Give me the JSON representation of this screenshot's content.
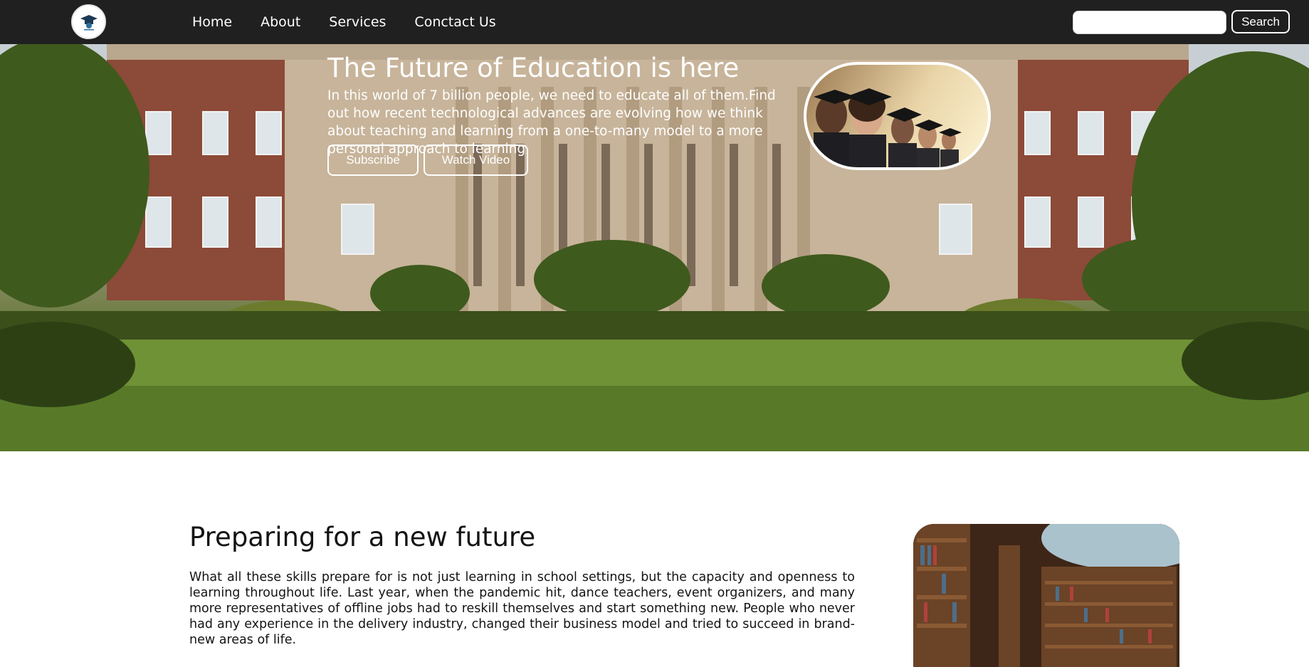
{
  "navbar": {
    "logo_icon": "graduation-cap-logo-icon",
    "links": [
      "Home",
      "About",
      "Services",
      "Conctact Us"
    ],
    "search": {
      "placeholder": "",
      "value": ""
    },
    "search_button_label": "Search"
  },
  "hero": {
    "title": "The Future of Education is here",
    "description": "In this world of 7 billion people, we need to educate all of them.Find out how recent technological advances are evolving how we think about teaching and learning from a one-to-many model to a more personal approach to learning.",
    "buttons": {
      "subscribe": "Subscribe",
      "watch": "Watch Video"
    },
    "background": "university-building-image",
    "side_image": "graduates-image"
  },
  "content": {
    "title": "Preparing for a new future",
    "paragraph": "What all these skills prepare for is not just learning in school settings, but the capacity and openness to learning throughout life. Last year, when the pandemic hit, dance teachers, event organizers, and many more representatives of offline jobs had to reskill themselves and start something new. People who never had any experience in the delivery industry, changed their business model and tried to succeed in brand-new areas of life.",
    "side_image": "library-image"
  },
  "colors": {
    "navbar_bg": "#202020",
    "hero_text": "#ffffff",
    "body_text": "#141414"
  }
}
